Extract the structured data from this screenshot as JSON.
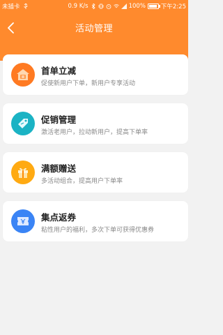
{
  "statusbar": {
    "carrier": "未插卡",
    "speed": "0.9 K/s",
    "battery": "100%",
    "time": "下午2:25"
  },
  "nav": {
    "title": "活动管理"
  },
  "colors": {
    "header": "#ff8a2d",
    "first_order": "#ff7a22",
    "promotion": "#1bb3c4",
    "full_gift": "#ffaa12",
    "points": "#3a84f5"
  },
  "cards": [
    {
      "icon": "house-coupon-icon",
      "title": "首单立减",
      "desc": "促使新用户下单，新用户专享活动"
    },
    {
      "icon": "price-tag-icon",
      "title": "促销管理",
      "desc": "激活老用户，拉动新用户，提高下单率"
    },
    {
      "icon": "gift-box-icon",
      "title": "满额赠送",
      "desc": "多活动组合，提高用户下单率"
    },
    {
      "icon": "ticket-icon",
      "title": "集点返券",
      "desc": "粘性用户的福利，多次下单可获得优惠券"
    }
  ]
}
